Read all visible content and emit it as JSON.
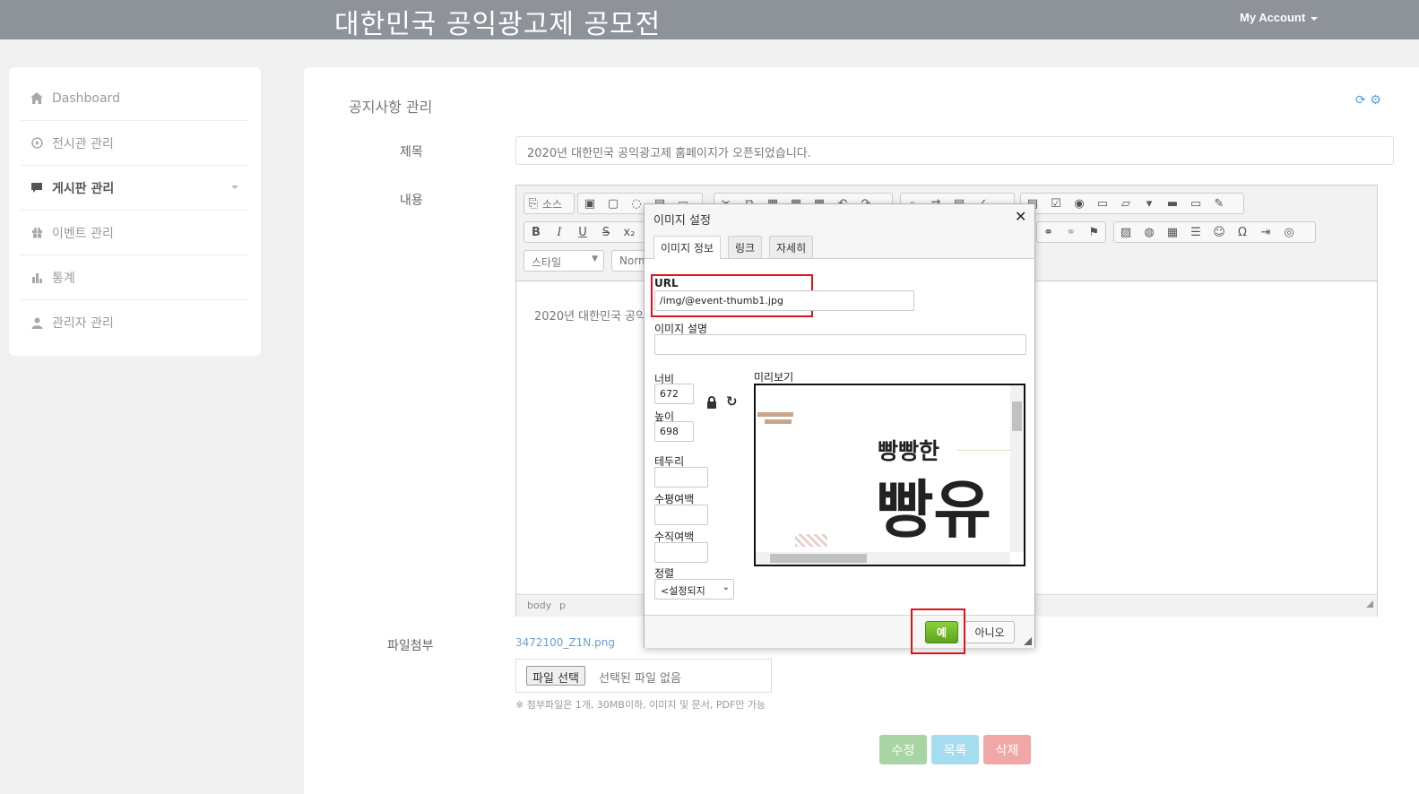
{
  "header": {
    "site_title": "대한민국 공익광고제 공모전",
    "account_label": "My Account"
  },
  "sidebar": {
    "items": [
      {
        "label": "Dashboard"
      },
      {
        "label": "전시관 관리"
      },
      {
        "label": "게시판 관리"
      },
      {
        "label": "이벤트 관리"
      },
      {
        "label": "통계"
      },
      {
        "label": "관리자 관리"
      }
    ]
  },
  "panel": {
    "title": "공지사항 관리"
  },
  "form": {
    "title_label": "제목",
    "title_value": "2020년 대한민국 공익광고제 홈페이지가 오픈되었습니다.",
    "content_label": "내용",
    "content_text": "2020년 대한민국 공익",
    "toolbar": {
      "source_label": "소스",
      "style_combo": "스타일",
      "format_combo": "Norm"
    },
    "status_path": [
      "body",
      "p"
    ],
    "attach_label": "파일첨부",
    "attached_file": "3472100_Z1N.png",
    "file_button": "파일 선택",
    "file_status": "선택된 파일 없음",
    "note": "※ 첨부파일은 1개, 30MB이하, 이미지 및 문서, PDF만 가능"
  },
  "actions": {
    "edit": "수정",
    "list": "목록",
    "delete": "삭제"
  },
  "colors": {
    "edit": "#a8d5a3",
    "list": "#a6dcef",
    "delete": "#f2a7a7",
    "topbar": "#8e9299"
  },
  "dialog": {
    "title": "이미지 설정",
    "tabs": [
      "이미지 정보",
      "링크",
      "자세히"
    ],
    "url_label": "URL",
    "url_value": "/img/@event-thumb1.jpg",
    "alt_label": "이미지 설명",
    "alt_value": "",
    "width_label": "너비",
    "width_value": "672",
    "height_label": "높이",
    "height_value": "698",
    "border_label": "테두리",
    "hspace_label": "수평여백",
    "vspace_label": "수직여백",
    "align_label": "정렬",
    "align_value": "<설정되지",
    "preview_label": "미리보기",
    "preview_text_small": "빵빵한",
    "preview_text_big": "빵유",
    "ok": "예",
    "cancel": "아니오"
  }
}
